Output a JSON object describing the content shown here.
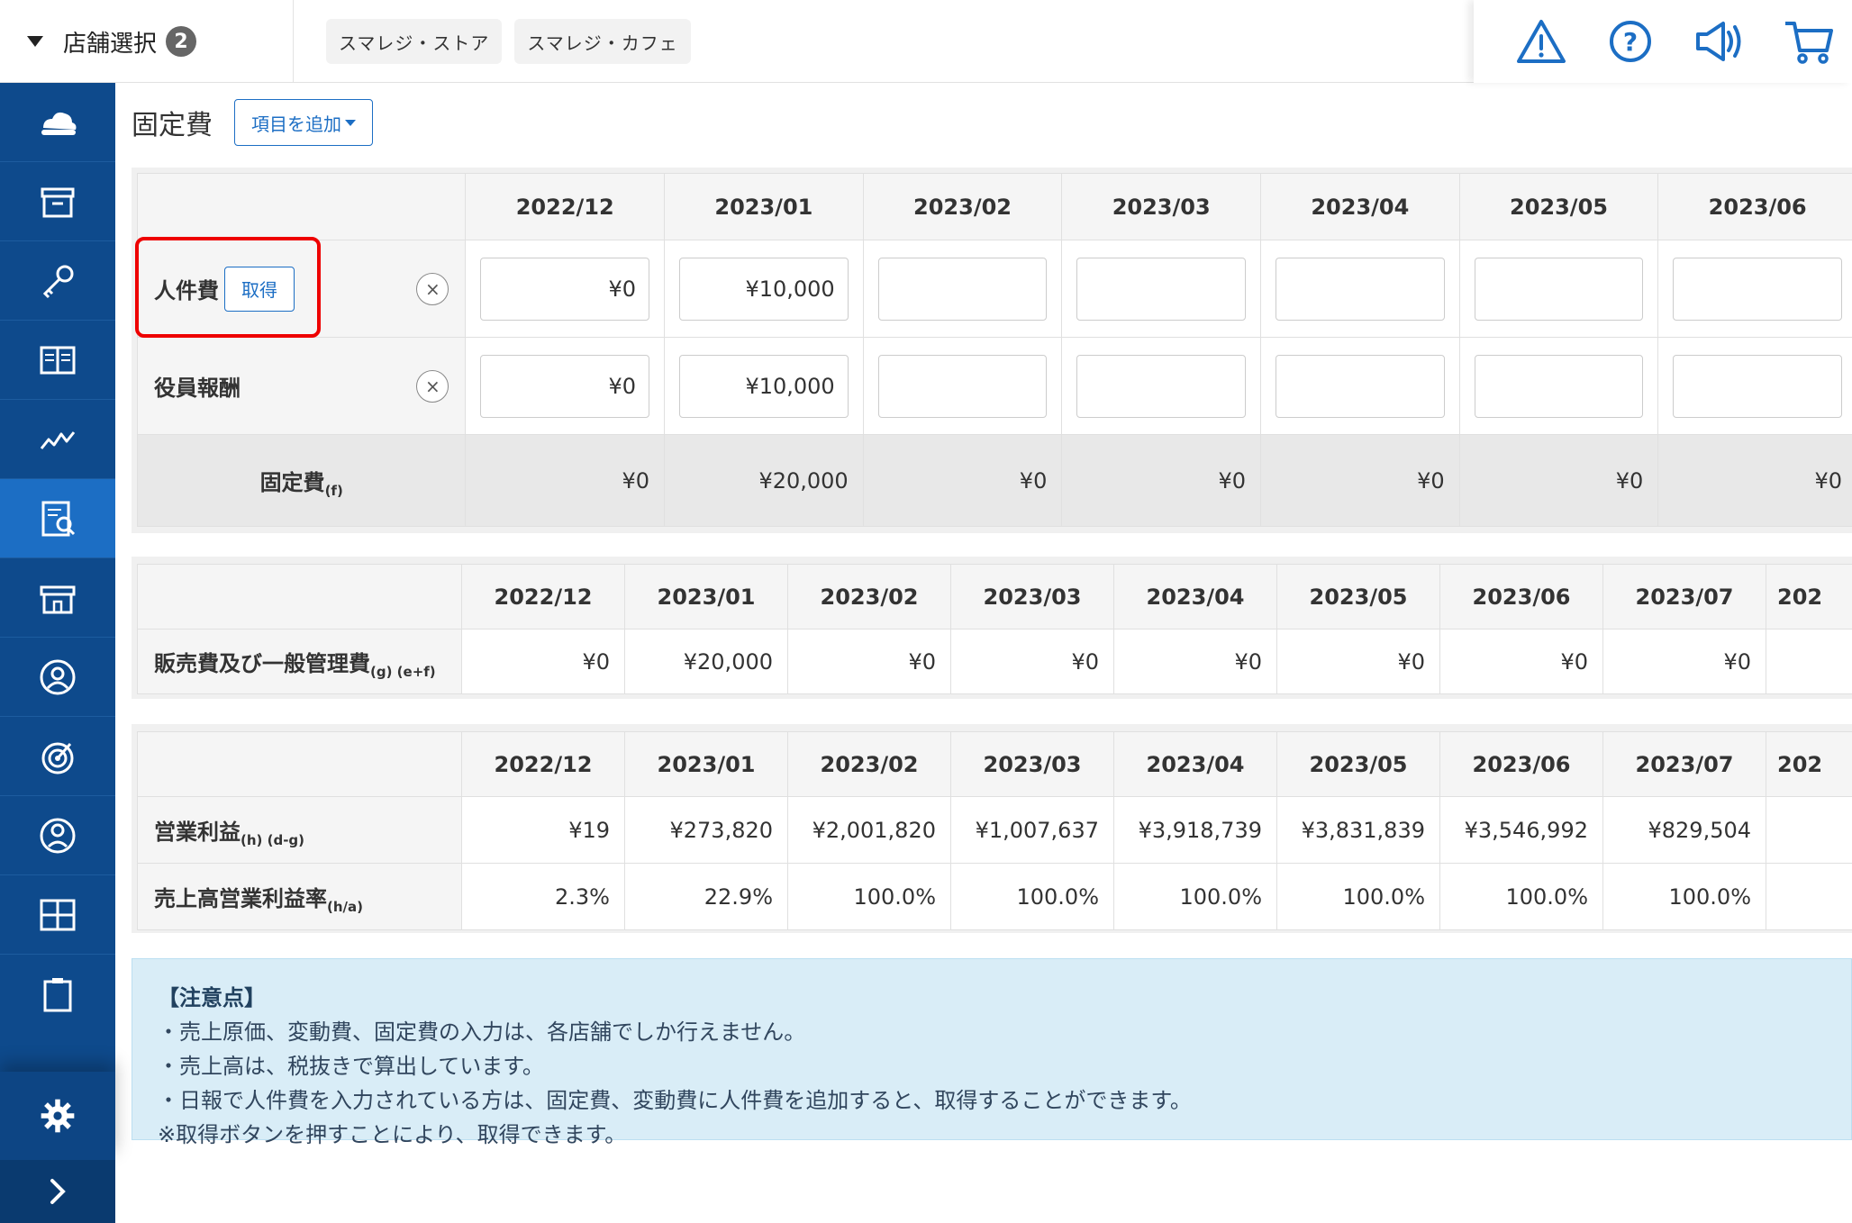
{
  "header": {
    "store_select_label": "店舗選択",
    "store_count": "2",
    "store_tabs": [
      "スマレジ・ストア",
      "スマレジ・カフェ"
    ],
    "icons": [
      "warning-icon",
      "help-icon",
      "megaphone-icon",
      "cart-icon"
    ]
  },
  "sidebar": {
    "items": [
      "cloud-icon",
      "archive-icon",
      "key-icon",
      "book-icon",
      "chart-icon",
      "report-icon",
      "store-icon",
      "user-icon",
      "target-icon",
      "person-icon",
      "grid-icon",
      "clipboard-icon"
    ],
    "active": "report-icon",
    "bottom": [
      "gear-icon",
      "chevron-right-icon"
    ]
  },
  "main": {
    "title": "固定費",
    "add_button": "項目を追加",
    "fixed_table": {
      "months": [
        "2022/12",
        "2023/01",
        "2023/02",
        "2023/03",
        "2023/04",
        "2023/05",
        "2023/06"
      ],
      "rows": [
        {
          "label": "人件費",
          "get_button": "取得",
          "delete": "×",
          "values": [
            "¥0",
            "¥10,000",
            "",
            "",
            "",
            "",
            ""
          ]
        },
        {
          "label": "役員報酬",
          "delete": "×",
          "values": [
            "¥0",
            "¥10,000",
            "",
            "",
            "",
            "",
            ""
          ]
        }
      ],
      "total": {
        "label": "固定費",
        "sub": "(f)",
        "values": [
          "¥0",
          "¥20,000",
          "¥0",
          "¥0",
          "¥0",
          "¥0",
          "¥0"
        ]
      }
    },
    "sga_table": {
      "months": [
        "2022/12",
        "2023/01",
        "2023/02",
        "2023/03",
        "2023/04",
        "2023/05",
        "2023/06",
        "2023/07",
        "202"
      ],
      "label": "販売費及び一般管理費",
      "sub": "(g) (e+f)",
      "values": [
        "¥0",
        "¥20,000",
        "¥0",
        "¥0",
        "¥0",
        "¥0",
        "¥0",
        "¥0",
        ""
      ]
    },
    "profit_table": {
      "months": [
        "2022/12",
        "2023/01",
        "2023/02",
        "2023/03",
        "2023/04",
        "2023/05",
        "2023/06",
        "2023/07",
        "202"
      ],
      "rows": [
        {
          "label": "営業利益",
          "sub": "(h) (d-g)",
          "values": [
            "¥19",
            "¥273,820",
            "¥2,001,820",
            "¥1,007,637",
            "¥3,918,739",
            "¥3,831,839",
            "¥3,546,992",
            "¥829,504",
            ""
          ]
        },
        {
          "label": "売上高営業利益率",
          "sub": "(h/a)",
          "values": [
            "2.3%",
            "22.9%",
            "100.0%",
            "100.0%",
            "100.0%",
            "100.0%",
            "100.0%",
            "100.0%",
            ""
          ]
        }
      ]
    },
    "notes": {
      "title": "【注意点】",
      "lines": [
        "・売上原価、変動費、固定費の入力は、各店舗でしか行えません。",
        "・売上高は、税抜きで算出しています。",
        "・日報で人件費を入力されている方は、固定費、変動費に人件費を追加すると、取得することができます。",
        "※取得ボタンを押すことにより、取得できます。"
      ]
    }
  }
}
